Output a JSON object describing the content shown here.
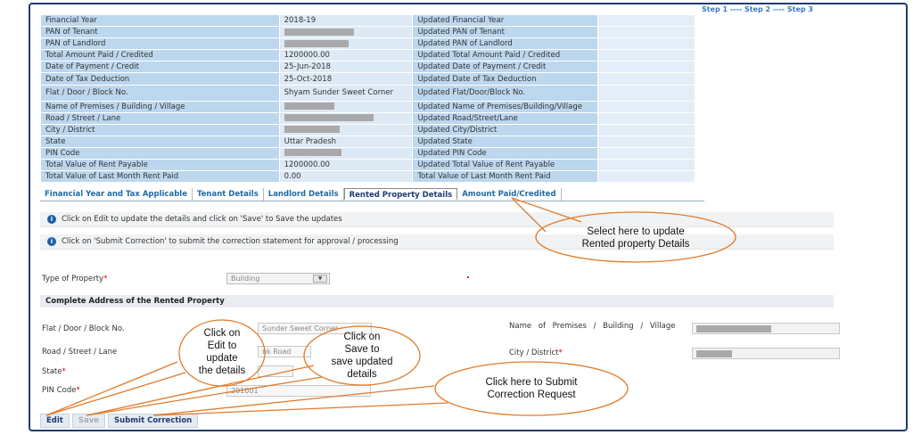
{
  "steps": [
    "Step 1",
    "----",
    "Step 2",
    "----",
    "Step 3"
  ],
  "summary_rows": [
    {
      "label": "Financial Year",
      "value": "2018-19",
      "updated_label": "Updated Financial Year",
      "redacted": false
    },
    {
      "label": "PAN of Tenant",
      "value": "",
      "updated_label": "Updated PAN of Tenant",
      "redacted": true
    },
    {
      "label": "PAN of Landlord",
      "value": "",
      "updated_label": "Updated PAN of Landlord",
      "redacted": true
    },
    {
      "label": "Total Amount Paid / Credited",
      "value": "1200000.00",
      "updated_label": "Updated Total Amount Paid / Credited",
      "redacted": false
    },
    {
      "label": "Date of Payment / Credit",
      "value": "25-Jun-2018",
      "updated_label": "Updated Date of Payment / Credit",
      "redacted": false
    },
    {
      "label": "Date of Tax Deduction",
      "value": "25-Oct-2018",
      "updated_label": "Updated Date of Tax Deduction",
      "redacted": false
    },
    {
      "label": "Flat / Door / Block No.",
      "value": "Shyam Sunder Sweet Corner",
      "updated_label": "Updated Flat/Door/Block No.",
      "redacted": false
    },
    {
      "label": "Name of Premises / Building / Village",
      "value": "",
      "updated_label": "Updated Name of Premises/Building/Village",
      "redacted": true
    },
    {
      "label": "Road / Street / Lane",
      "value": "",
      "updated_label": "Updated Road/Street/Lane",
      "redacted": true
    },
    {
      "label": "City / District",
      "value": "",
      "updated_label": "Updated City/District",
      "redacted": true
    },
    {
      "label": "State",
      "value": "Uttar Pradesh",
      "updated_label": "Updated State",
      "redacted": false
    },
    {
      "label": "PIN Code",
      "value": "",
      "updated_label": "Updated PIN Code",
      "redacted": true
    },
    {
      "label": "Total Value of Rent Payable",
      "value": "1200000.00",
      "updated_label": "Updated Total Value of Rent Payable",
      "redacted": false
    },
    {
      "label": "Total Value of Last Month Rent Paid",
      "value": "0.00",
      "updated_label": "Total Value of Last Month Rent Paid",
      "redacted": false
    }
  ],
  "tabs": [
    {
      "label": "Financial Year and Tax Applicable",
      "active": false
    },
    {
      "label": "Tenant Details",
      "active": false
    },
    {
      "label": "Landlord Details",
      "active": false
    },
    {
      "label": "Rented Property Details",
      "active": true
    },
    {
      "label": "Amount Paid/Credited",
      "active": false
    }
  ],
  "info": {
    "line1": "Click on Edit to update the details and click on 'Save' to Save the updates",
    "line2": "Click on 'Submit Correction' to submit the correction statement for approval / processing"
  },
  "form": {
    "type_label": "Type of Property",
    "type_value": "Building",
    "section_title": "Complete Address of the Rented Property",
    "flat_label": "Flat / Door / Block No.",
    "flat_value": "Sunder Sweet Corner",
    "road_label": "Road / Street / Lane",
    "road_value": "nk Road",
    "state_label": "State",
    "pin_label": "PIN Code",
    "pin_value": "201001",
    "premises_label": "Name of Premises / Building / Village",
    "city_label": "City / District",
    "required_mark": "*"
  },
  "buttons": {
    "edit": "Edit",
    "save": "Save",
    "submit": "Submit Correction"
  },
  "callouts": {
    "rented": [
      "Select here to update",
      "Rented property Details"
    ],
    "edit": [
      "Click on",
      "Edit to",
      "update",
      "the details"
    ],
    "save": [
      "Click on",
      "Save to",
      "save updated",
      "details"
    ],
    "submit": [
      "Click here to  Submit",
      "Correction Request"
    ]
  },
  "colors": {
    "frame": "#1f3b73",
    "label_cell": "#bcd7ee",
    "callout_stroke": "#e07b2a",
    "tab_text": "#1e6aa6"
  }
}
